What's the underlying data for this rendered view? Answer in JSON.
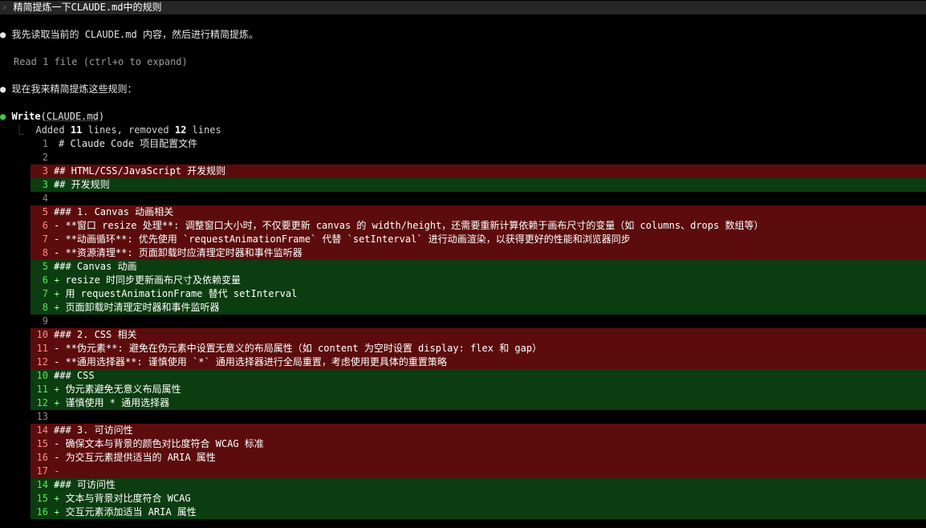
{
  "prompt": {
    "text": "精简提炼一下CLAUDE.md中的规则"
  },
  "messages": {
    "m1": "我先读取当前的 CLAUDE.md 内容，然后进行精简提炼。",
    "read_status": "Read 1 file (ctrl+o to expand)",
    "m2": "现在我来精简提炼这些规则：",
    "tool_name": "Write",
    "tool_arg": "CLAUDE.md",
    "summary_prefix": "Added ",
    "summary_added": "11",
    "summary_mid": " lines, removed ",
    "summary_removed": "12",
    "summary_suffix": " lines"
  },
  "colors": {
    "background": "#000000",
    "prompt_bar": "#262626",
    "diff_removed_bg": "#5c0c0c",
    "diff_added_bg": "#0b3d10",
    "bullet_green": "#3fcf3f"
  },
  "diff": [
    {
      "type": "ctx",
      "num": "1",
      "text": "# Claude Code 项目配置文件"
    },
    {
      "type": "ctx",
      "num": "2",
      "text": ""
    },
    {
      "type": "del",
      "num": "3",
      "text": "## HTML/CSS/JavaScript 开发规则"
    },
    {
      "type": "add",
      "num": "3",
      "text": "## 开发规则"
    },
    {
      "type": "ctx",
      "num": "4",
      "text": ""
    },
    {
      "type": "del",
      "num": "5",
      "text": "### 1. Canvas 动画相关"
    },
    {
      "type": "del",
      "num": "6",
      "text": "- **窗口 resize 处理**: 调整窗口大小时，不仅要更新 canvas 的 width/height，还需要重新计算依赖于画布尺寸的变量（如 columns、drops 数组等）"
    },
    {
      "type": "del",
      "num": "7",
      "text": "- **动画循环**: 优先使用 `requestAnimationFrame` 代替 `setInterval` 进行动画渲染，以获得更好的性能和浏览器同步"
    },
    {
      "type": "del",
      "num": "8",
      "text": "- **资源清理**: 页面卸载时应清理定时器和事件监听器"
    },
    {
      "type": "add",
      "num": "5",
      "text": "### Canvas 动画"
    },
    {
      "type": "add",
      "num": "6",
      "text": "- resize 时同步更新画布尺寸及依赖变量"
    },
    {
      "type": "add",
      "num": "7",
      "text": "- 用 requestAnimationFrame 替代 setInterval"
    },
    {
      "type": "add",
      "num": "8",
      "text": "- 页面卸载时清理定时器和事件监听器"
    },
    {
      "type": "ctx",
      "num": "9",
      "text": ""
    },
    {
      "type": "del",
      "num": "10",
      "text": "### 2. CSS 相关"
    },
    {
      "type": "del",
      "num": "11",
      "text": "- **伪元素**: 避免在伪元素中设置无意义的布局属性（如 content 为空时设置 display: flex 和 gap）"
    },
    {
      "type": "del",
      "num": "12",
      "text": "- **通用选择器**: 谨慎使用 `*` 通用选择器进行全局重置，考虑使用更具体的重置策略"
    },
    {
      "type": "add",
      "num": "10",
      "text": "### CSS"
    },
    {
      "type": "add",
      "num": "11",
      "text": "- 伪元素避免无意义布局属性"
    },
    {
      "type": "add",
      "num": "12",
      "text": "- 谨慎使用 * 通用选择器"
    },
    {
      "type": "ctx",
      "num": "13",
      "text": ""
    },
    {
      "type": "del",
      "num": "14",
      "text": "### 3. 可访问性"
    },
    {
      "type": "del",
      "num": "15",
      "text": "- 确保文本与背景的颜色对比度符合 WCAG 标准"
    },
    {
      "type": "del",
      "num": "16",
      "text": "- 为交互元素提供适当的 ARIA 属性"
    },
    {
      "type": "del",
      "num": "17",
      "text": ""
    },
    {
      "type": "add",
      "num": "14",
      "text": "### 可访问性"
    },
    {
      "type": "add",
      "num": "15",
      "text": "- 文本与背景对比度符合 WCAG"
    },
    {
      "type": "add",
      "num": "16",
      "text": "- 交互元素添加适当 ARIA 属性"
    }
  ]
}
